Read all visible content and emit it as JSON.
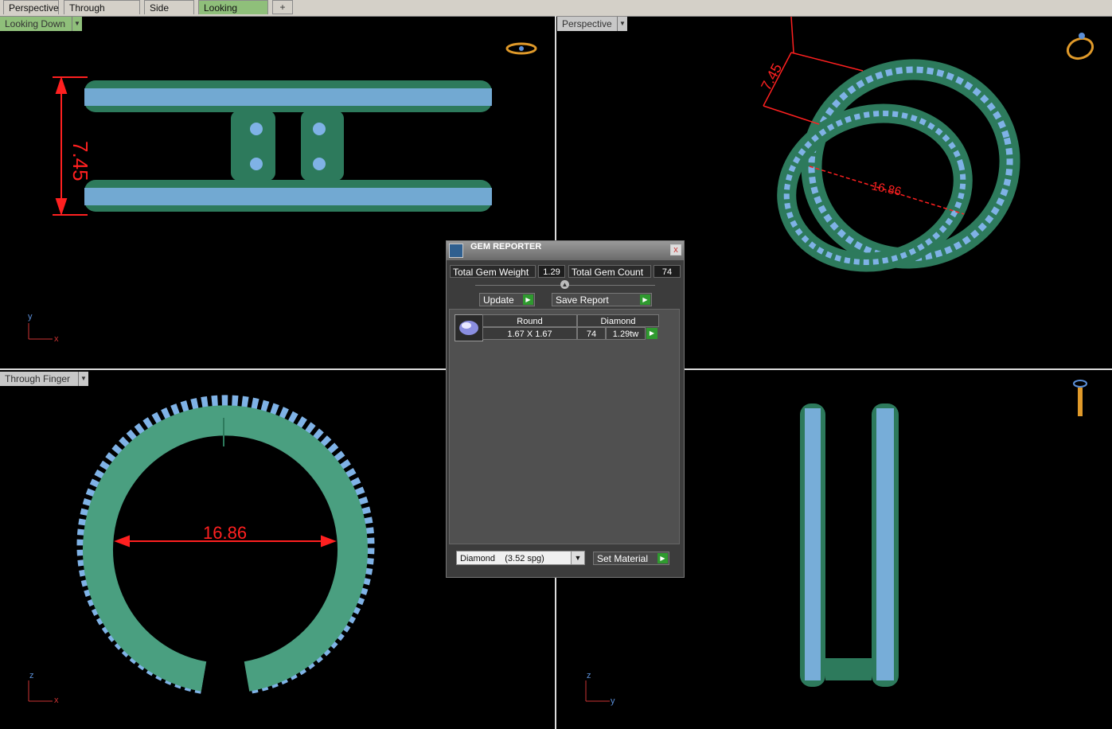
{
  "tabs": [
    "Perspective",
    "Through Finger",
    "Side View",
    "Looking Down"
  ],
  "tab_add": "+",
  "viewports": {
    "top_left": {
      "label": "Looking Down",
      "dimension": "7.45",
      "axis_v": "y",
      "axis_h": "x"
    },
    "top_right": {
      "label": "Perspective",
      "dimension_a": "7.45",
      "dimension_b": "16.86"
    },
    "bottom_left": {
      "label": "Through Finger",
      "dimension": "16.86",
      "axis_v": "z",
      "axis_h": "x"
    },
    "bottom_right": {
      "axis_v": "z",
      "axis_h": "y"
    }
  },
  "gem_reporter": {
    "title": "GEM REPORTER",
    "close": "x",
    "total_weight_label": "Total Gem Weight",
    "total_weight_value": "1.29",
    "total_count_label": "Total Gem Count",
    "total_count_value": "74",
    "update_label": "Update",
    "save_report_label": "Save Report",
    "row": {
      "shape": "Round",
      "material": "Diamond",
      "size": "1.67 X 1.67",
      "count": "74",
      "weight": "1.29tw"
    },
    "material_select": "Diamond    (3.52 spg)",
    "set_material_label": "Set Material"
  },
  "colors": {
    "metal": "#2d7a5c",
    "gem": "#7fb2e6",
    "dimension": "#ff2020",
    "accent": "#8fbf7a"
  }
}
